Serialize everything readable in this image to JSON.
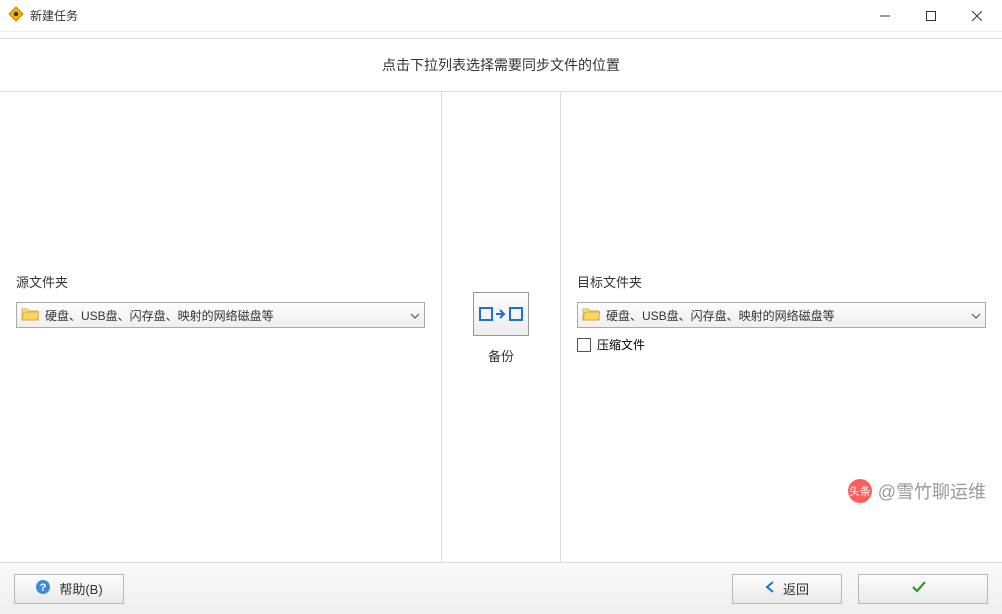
{
  "window": {
    "title": "新建任务"
  },
  "instruction": "点击下拉列表选择需要同步文件的位置",
  "source": {
    "label": "源文件夹",
    "dropdown_text": "硬盘、USB盘、闪存盘、映射的网络磁盘等"
  },
  "target": {
    "label": "目标文件夹",
    "dropdown_text": "硬盘、USB盘、闪存盘、映射的网络磁盘等",
    "compress_label": "压缩文件",
    "compress_checked": false
  },
  "center": {
    "backup_label": "备份"
  },
  "footer": {
    "help_label": "帮助(B)",
    "back_label": "返回",
    "confirm_label": ""
  },
  "watermark": {
    "brand": "头条",
    "handle": "@雪竹聊运维"
  }
}
